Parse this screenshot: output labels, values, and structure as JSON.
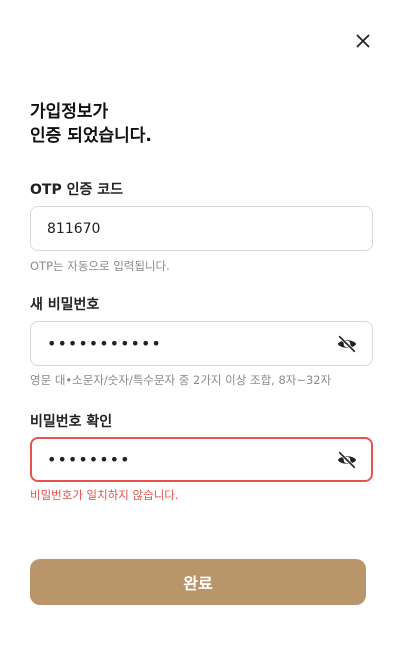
{
  "title": {
    "line1": "가입정보가",
    "line2": "인증 되었습니다."
  },
  "otp": {
    "label": "OTP 인증 코드",
    "value": "811670",
    "hint": "OTP는 자동으로 입력됩니다."
  },
  "new_password": {
    "label": "새 비밀번호",
    "value": "•••••••••••",
    "hint": "영문 대•소문자/숫자/특수문자 중 2가지 이상 조합, 8자~32자"
  },
  "confirm_password": {
    "label": "비밀번호 확인",
    "value": "••••••••",
    "error": "비밀번호가 일치하지 않습니다."
  },
  "submit_label": "완료",
  "colors": {
    "accent": "#b8956b",
    "error": "#e5534b",
    "border": "#d9d9d9",
    "hint": "#8a8a8a"
  },
  "icons": {
    "close": "close-icon",
    "visibility": "eye-off-icon"
  }
}
